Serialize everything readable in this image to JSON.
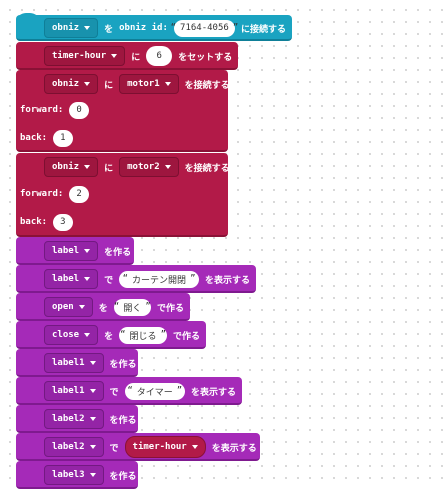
{
  "blocks": {
    "connect": {
      "obj": "obniz",
      "w1": "を",
      "idlabel": "obniz id:",
      "id": "7164-4056",
      "tail": "に接続する"
    },
    "timer_set": {
      "var": "timer-hour",
      "w1": "に",
      "value": "6",
      "tail": "をセットする"
    },
    "motor1": {
      "obj": "obniz",
      "w1": "に",
      "motor": "motor1",
      "tail": "を接続する",
      "forward_label": "forward:",
      "forward": "0",
      "back_label": "back:",
      "back": "1"
    },
    "motor2": {
      "obj": "obniz",
      "w1": "に",
      "motor": "motor2",
      "tail": "を接続する",
      "forward_label": "forward:",
      "forward": "2",
      "back_label": "back:",
      "back": "3"
    },
    "label_make": {
      "obj": "label",
      "tail": "を作る"
    },
    "label_show": {
      "obj": "label",
      "w1": "で",
      "text": "カーテン開閉",
      "tail": "を表示する"
    },
    "open_btn": {
      "obj": "open",
      "w1": "を",
      "text": "開く",
      "tail": "で作る"
    },
    "close_btn": {
      "obj": "close",
      "w1": "を",
      "text": "閉じる",
      "tail": "で作る"
    },
    "label1_make": {
      "obj": "label1",
      "tail": "を作る"
    },
    "label1_show": {
      "obj": "label1",
      "w1": "で",
      "text": "タイマー",
      "tail": "を表示する"
    },
    "label2_make": {
      "obj": "label2",
      "tail": "を作る"
    },
    "label2_show": {
      "obj": "label2",
      "w1": "で",
      "var": "timer-hour",
      "tail": "を表示する"
    },
    "label3_make": {
      "obj": "label3",
      "tail": "を作る"
    }
  },
  "quote_open": "“",
  "quote_close": "”",
  "colors": {
    "obniz_block": "#1aa3c1",
    "variable_block": "#b21a48",
    "ui_block": "#a52ab8"
  }
}
